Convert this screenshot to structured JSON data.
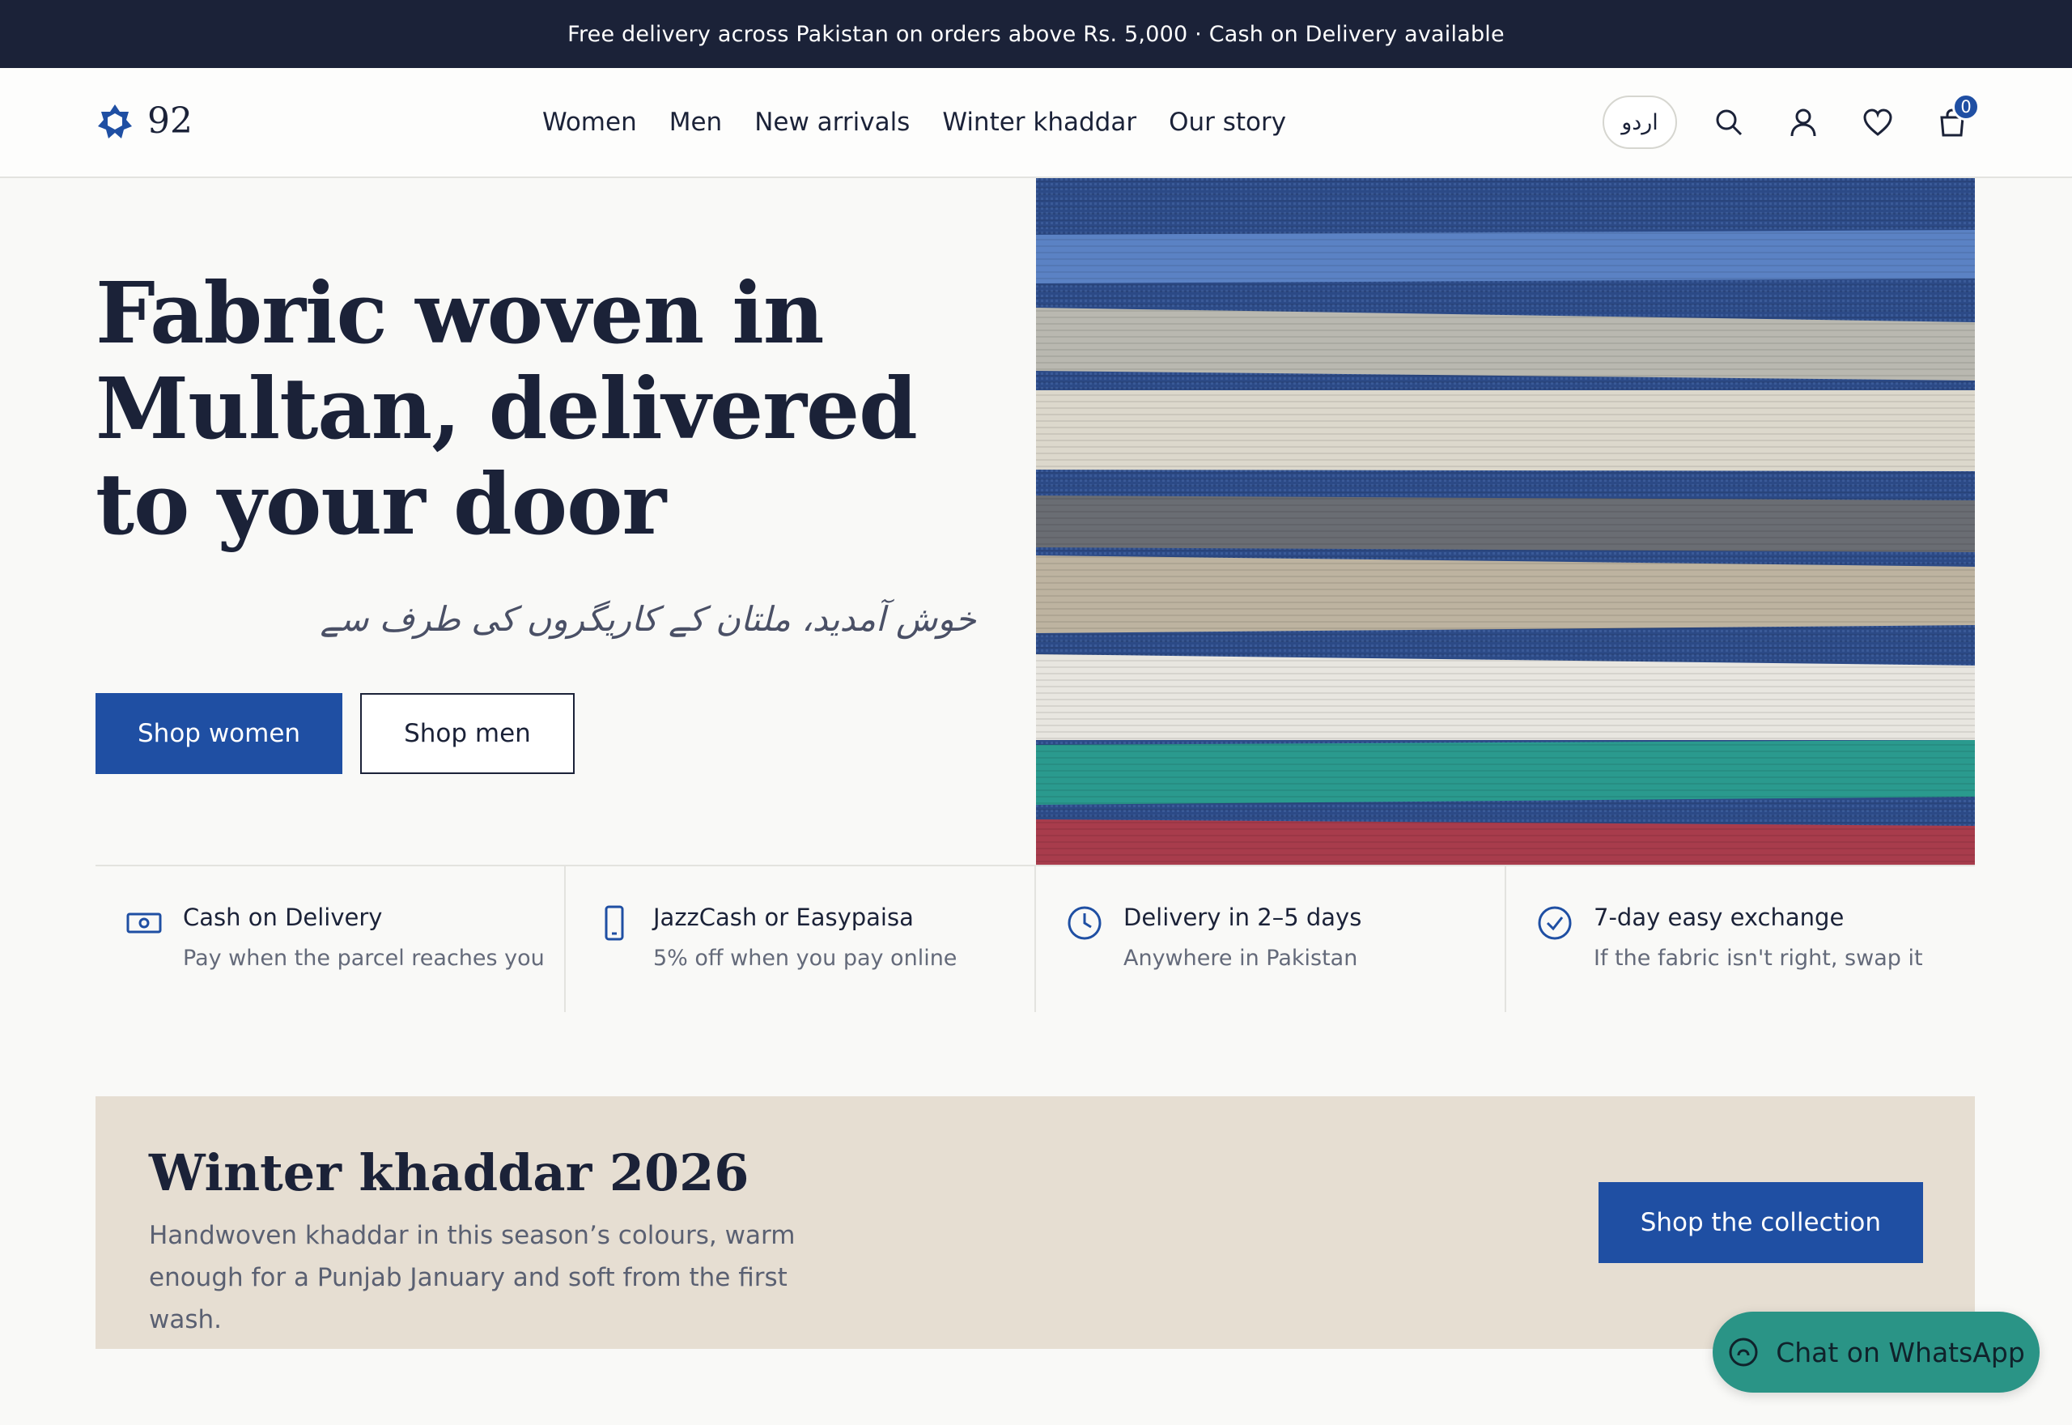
{
  "announcement": "Free delivery across Pakistan on orders above Rs. 5,000 · Cash on Delivery available",
  "brand": {
    "name": "92",
    "accent": "#1f4fa3",
    "dark": "#1b2238",
    "whatsapp_color": "#2a9486"
  },
  "nav": {
    "items": [
      "Women",
      "Men",
      "New arrivals",
      "Winter khaddar",
      "Our story"
    ]
  },
  "header_tools": {
    "lang_label": "اردو",
    "icons": [
      "search-icon",
      "user-icon",
      "heart-icon",
      "bag-icon"
    ],
    "cart_count": "0"
  },
  "hero": {
    "title": "Fabric woven in Multan, delivered to your door",
    "urdu_tagline": "خوش آمدید، ملتان کے کاریگروں کی طرف سے",
    "primary_cta": "Shop women",
    "secondary_cta": "Shop men"
  },
  "features": [
    {
      "icon": "cash-icon",
      "title": "Cash on Delivery",
      "subtitle": "Pay when the parcel reaches you"
    },
    {
      "icon": "phone-icon",
      "title": "JazzCash or Easypaisa",
      "subtitle": "5% off when you pay online"
    },
    {
      "icon": "clock-icon",
      "title": "Delivery in 2–5 days",
      "subtitle": "Anywhere in Pakistan"
    },
    {
      "icon": "check-circle-icon",
      "title": "7-day easy exchange",
      "subtitle": "If the fabric isn't right, swap it"
    }
  ],
  "promo": {
    "title": "Winter khaddar 2026",
    "text": "Handwoven khaddar in this season’s colours, warm enough for a Punjab January and soft from the first wash.",
    "cta": "Shop the collection"
  },
  "whatsapp": {
    "label": "Chat on WhatsApp"
  }
}
